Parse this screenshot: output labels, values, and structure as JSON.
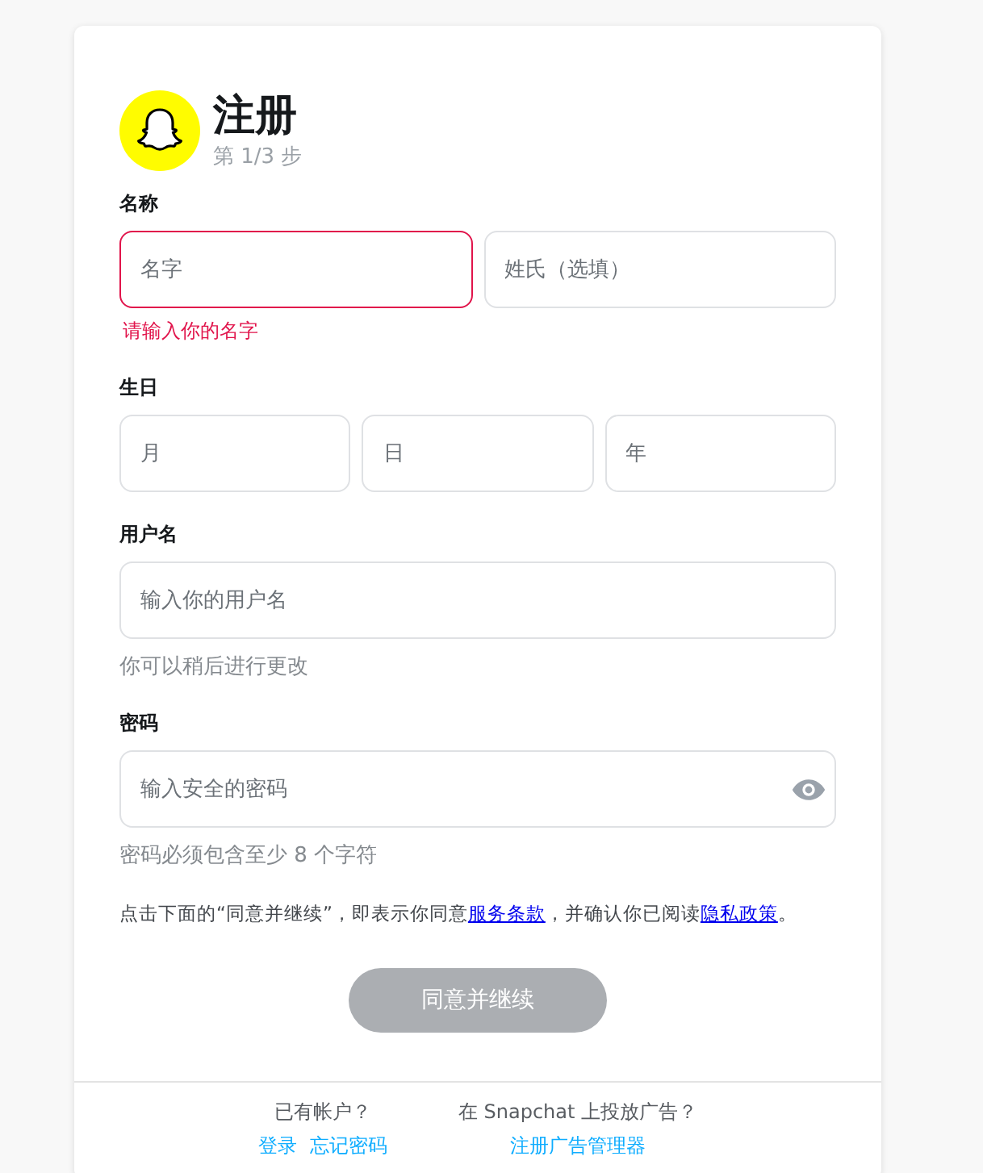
{
  "header": {
    "title": "注册",
    "step": "第 1/3 步"
  },
  "sections": [
    {
      "label": "名称",
      "fields": [
        {
          "placeholder": "名字",
          "invalid": true
        },
        {
          "placeholder": "姓氏（选填）",
          "invalid": false
        }
      ],
      "error": "请输入你的名字"
    },
    {
      "label": "生日",
      "fields": [
        {
          "placeholder": "月",
          "invalid": false
        },
        {
          "placeholder": "日",
          "invalid": false
        },
        {
          "placeholder": "年",
          "invalid": false
        }
      ]
    },
    {
      "label": "用户名",
      "fields": [
        {
          "placeholder": "输入你的用户名",
          "invalid": false
        }
      ],
      "hint": "你可以稍后进行更改"
    },
    {
      "label": "密码",
      "fields": [
        {
          "placeholder": "输入安全的密码",
          "invalid": false,
          "kind": "password"
        }
      ],
      "hint": "密码必须包含至少 8 个字符"
    }
  ],
  "terms": [
    {
      "kind": "text",
      "text": "点击下面的“同意并继续”，即表示你同意"
    },
    {
      "kind": "link",
      "text": "服务条款"
    },
    {
      "kind": "text",
      "text": "，并确认你已阅读"
    },
    {
      "kind": "link",
      "text": "隐私政策"
    },
    {
      "kind": "text",
      "text": "。"
    }
  ],
  "submit": {
    "label": "同意并继续",
    "disabled": true
  },
  "footer": [
    {
      "question": "已有帐户？",
      "links": [
        "登录",
        "忘记密码"
      ]
    },
    {
      "question": "在 Snapchat 上投放广告？",
      "links": [
        "注册广告管理器"
      ]
    }
  ]
}
